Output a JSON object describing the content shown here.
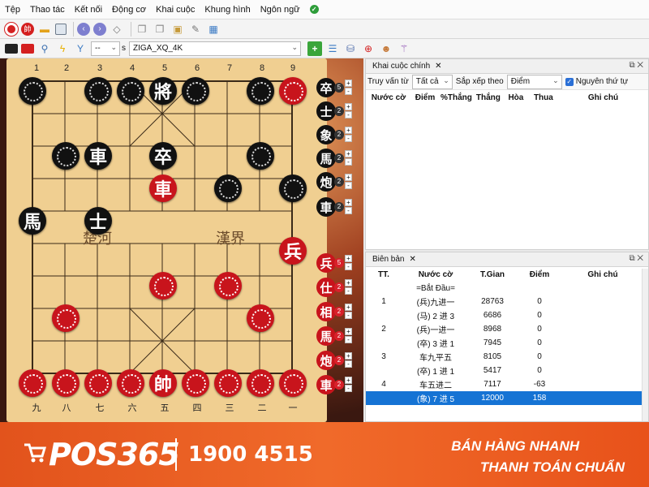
{
  "menu": [
    "Tệp",
    "Thao tác",
    "Kết nối",
    "Động cơ",
    "Khai cuộc",
    "Khung hình",
    "Ngôn ngữ"
  ],
  "toolbar2": {
    "speed_value": "--",
    "speed_unit": "s",
    "engine_value": "ZIGA_XQ_4K"
  },
  "board": {
    "top_coords": [
      "1",
      "2",
      "3",
      "4",
      "5",
      "6",
      "7",
      "8",
      "9"
    ],
    "bottom_coords": [
      "九",
      "八",
      "七",
      "六",
      "五",
      "四",
      "三",
      "二",
      "一"
    ],
    "river_left": "楚河",
    "river_right": "漢界"
  },
  "pieces": {
    "black_general": "將",
    "black_chariot": "車",
    "black_soldier": "卒",
    "black_horse": "馬",
    "black_advisor": "士",
    "red_chariot": "車",
    "red_soldier": "兵",
    "red_general": "帥"
  },
  "captured_black": [
    {
      "glyph": "卒",
      "count": "5"
    },
    {
      "glyph": "士",
      "count": "2"
    },
    {
      "glyph": "象",
      "count": "2"
    },
    {
      "glyph": "馬",
      "count": "2"
    },
    {
      "glyph": "炮",
      "count": "2"
    },
    {
      "glyph": "車",
      "count": "2"
    }
  ],
  "captured_red": [
    {
      "glyph": "兵",
      "count": "5"
    },
    {
      "glyph": "仕",
      "count": "2"
    },
    {
      "glyph": "相",
      "count": "2"
    },
    {
      "glyph": "馬",
      "count": "2"
    },
    {
      "glyph": "炮",
      "count": "2"
    },
    {
      "glyph": "車",
      "count": "2"
    }
  ],
  "opening_panel": {
    "tab": "Khai cuộc chính",
    "filter_label": "Truy vấn từ",
    "filter_value": "Tất cả",
    "sort_label": "Sắp xếp theo",
    "sort_value": "Điểm",
    "original_order": "Nguyên thứ tự",
    "columns": [
      "Nước cờ",
      "Điểm",
      "%Thắng",
      "Thắng",
      "Hòa",
      "Thua",
      "Ghi chú"
    ]
  },
  "record_panel": {
    "tab": "Biên bản",
    "columns": [
      "TT.",
      "Nước cờ",
      "T.Gian",
      "Điểm",
      "Ghi chú"
    ],
    "rows": [
      {
        "tt": "",
        "move": "=Bắt Đầu=",
        "time": "",
        "score": ""
      },
      {
        "tt": "1",
        "move": "(兵)九进一",
        "time": "28763",
        "score": "0"
      },
      {
        "tt": "",
        "move": "(马) 2 进 3",
        "time": "6686",
        "score": "0"
      },
      {
        "tt": "2",
        "move": "(兵)一进一",
        "time": "8968",
        "score": "0"
      },
      {
        "tt": "",
        "move": "(卒) 3 进 1",
        "time": "7945",
        "score": "0"
      },
      {
        "tt": "3",
        "move": "车九平五",
        "time": "8105",
        "score": "0"
      },
      {
        "tt": "",
        "move": "(卒) 1 进 1",
        "time": "5417",
        "score": "0"
      },
      {
        "tt": "4",
        "move": "车五进二",
        "time": "7117",
        "score": "-63"
      },
      {
        "tt": "",
        "move": "(象) 7 进 5",
        "time": "12000",
        "score": "158"
      }
    ]
  },
  "banner": {
    "logo": "POS365",
    "phone": "1900 4515",
    "slogan1": "BÁN HÀNG NHANH",
    "slogan2": "THANH TOÁN CHUẨN"
  },
  "colors": {
    "accent_blue": "#1573d4",
    "piece_red": "#c8141c",
    "piece_black": "#111111",
    "board": "#f0cf91",
    "banner": "#f06a2a"
  }
}
